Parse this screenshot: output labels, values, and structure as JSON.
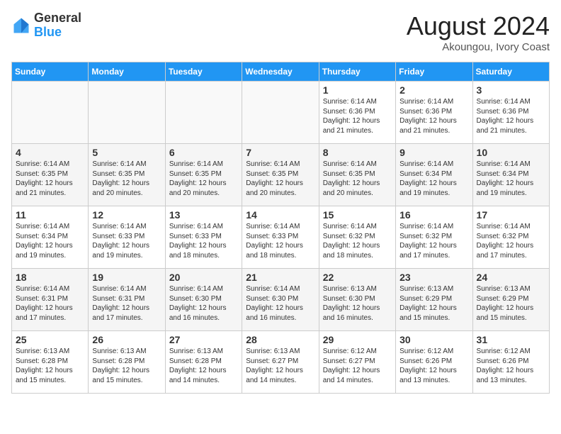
{
  "header": {
    "logo_general": "General",
    "logo_blue": "Blue",
    "month_title": "August 2024",
    "location": "Akoungou, Ivory Coast"
  },
  "days_of_week": [
    "Sunday",
    "Monday",
    "Tuesday",
    "Wednesday",
    "Thursday",
    "Friday",
    "Saturday"
  ],
  "weeks": [
    [
      {
        "num": "",
        "info": ""
      },
      {
        "num": "",
        "info": ""
      },
      {
        "num": "",
        "info": ""
      },
      {
        "num": "",
        "info": ""
      },
      {
        "num": "1",
        "info": "Sunrise: 6:14 AM\nSunset: 6:36 PM\nDaylight: 12 hours\nand 21 minutes."
      },
      {
        "num": "2",
        "info": "Sunrise: 6:14 AM\nSunset: 6:36 PM\nDaylight: 12 hours\nand 21 minutes."
      },
      {
        "num": "3",
        "info": "Sunrise: 6:14 AM\nSunset: 6:36 PM\nDaylight: 12 hours\nand 21 minutes."
      }
    ],
    [
      {
        "num": "4",
        "info": "Sunrise: 6:14 AM\nSunset: 6:35 PM\nDaylight: 12 hours\nand 21 minutes."
      },
      {
        "num": "5",
        "info": "Sunrise: 6:14 AM\nSunset: 6:35 PM\nDaylight: 12 hours\nand 20 minutes."
      },
      {
        "num": "6",
        "info": "Sunrise: 6:14 AM\nSunset: 6:35 PM\nDaylight: 12 hours\nand 20 minutes."
      },
      {
        "num": "7",
        "info": "Sunrise: 6:14 AM\nSunset: 6:35 PM\nDaylight: 12 hours\nand 20 minutes."
      },
      {
        "num": "8",
        "info": "Sunrise: 6:14 AM\nSunset: 6:35 PM\nDaylight: 12 hours\nand 20 minutes."
      },
      {
        "num": "9",
        "info": "Sunrise: 6:14 AM\nSunset: 6:34 PM\nDaylight: 12 hours\nand 19 minutes."
      },
      {
        "num": "10",
        "info": "Sunrise: 6:14 AM\nSunset: 6:34 PM\nDaylight: 12 hours\nand 19 minutes."
      }
    ],
    [
      {
        "num": "11",
        "info": "Sunrise: 6:14 AM\nSunset: 6:34 PM\nDaylight: 12 hours\nand 19 minutes."
      },
      {
        "num": "12",
        "info": "Sunrise: 6:14 AM\nSunset: 6:33 PM\nDaylight: 12 hours\nand 19 minutes."
      },
      {
        "num": "13",
        "info": "Sunrise: 6:14 AM\nSunset: 6:33 PM\nDaylight: 12 hours\nand 18 minutes."
      },
      {
        "num": "14",
        "info": "Sunrise: 6:14 AM\nSunset: 6:33 PM\nDaylight: 12 hours\nand 18 minutes."
      },
      {
        "num": "15",
        "info": "Sunrise: 6:14 AM\nSunset: 6:32 PM\nDaylight: 12 hours\nand 18 minutes."
      },
      {
        "num": "16",
        "info": "Sunrise: 6:14 AM\nSunset: 6:32 PM\nDaylight: 12 hours\nand 17 minutes."
      },
      {
        "num": "17",
        "info": "Sunrise: 6:14 AM\nSunset: 6:32 PM\nDaylight: 12 hours\nand 17 minutes."
      }
    ],
    [
      {
        "num": "18",
        "info": "Sunrise: 6:14 AM\nSunset: 6:31 PM\nDaylight: 12 hours\nand 17 minutes."
      },
      {
        "num": "19",
        "info": "Sunrise: 6:14 AM\nSunset: 6:31 PM\nDaylight: 12 hours\nand 17 minutes."
      },
      {
        "num": "20",
        "info": "Sunrise: 6:14 AM\nSunset: 6:30 PM\nDaylight: 12 hours\nand 16 minutes."
      },
      {
        "num": "21",
        "info": "Sunrise: 6:14 AM\nSunset: 6:30 PM\nDaylight: 12 hours\nand 16 minutes."
      },
      {
        "num": "22",
        "info": "Sunrise: 6:13 AM\nSunset: 6:30 PM\nDaylight: 12 hours\nand 16 minutes."
      },
      {
        "num": "23",
        "info": "Sunrise: 6:13 AM\nSunset: 6:29 PM\nDaylight: 12 hours\nand 15 minutes."
      },
      {
        "num": "24",
        "info": "Sunrise: 6:13 AM\nSunset: 6:29 PM\nDaylight: 12 hours\nand 15 minutes."
      }
    ],
    [
      {
        "num": "25",
        "info": "Sunrise: 6:13 AM\nSunset: 6:28 PM\nDaylight: 12 hours\nand 15 minutes."
      },
      {
        "num": "26",
        "info": "Sunrise: 6:13 AM\nSunset: 6:28 PM\nDaylight: 12 hours\nand 15 minutes."
      },
      {
        "num": "27",
        "info": "Sunrise: 6:13 AM\nSunset: 6:28 PM\nDaylight: 12 hours\nand 14 minutes."
      },
      {
        "num": "28",
        "info": "Sunrise: 6:13 AM\nSunset: 6:27 PM\nDaylight: 12 hours\nand 14 minutes."
      },
      {
        "num": "29",
        "info": "Sunrise: 6:12 AM\nSunset: 6:27 PM\nDaylight: 12 hours\nand 14 minutes."
      },
      {
        "num": "30",
        "info": "Sunrise: 6:12 AM\nSunset: 6:26 PM\nDaylight: 12 hours\nand 13 minutes."
      },
      {
        "num": "31",
        "info": "Sunrise: 6:12 AM\nSunset: 6:26 PM\nDaylight: 12 hours\nand 13 minutes."
      }
    ]
  ]
}
